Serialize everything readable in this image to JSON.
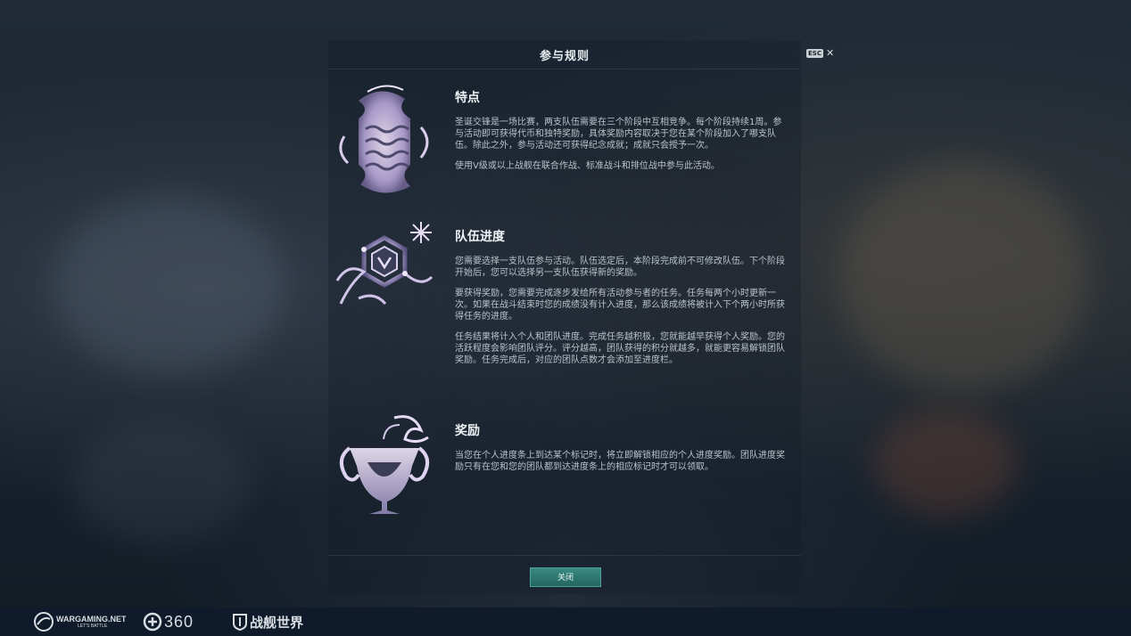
{
  "dialog": {
    "title": "参与规则",
    "esc_label": "ESC",
    "close_glyph": "✕",
    "close_button_label": "关闭"
  },
  "sections": [
    {
      "title": "特点",
      "icon": "waves-emblem-icon",
      "paragraphs": [
        "圣诞交锋是一场比赛，两支队伍需要在三个阶段中互相竞争。每个阶段持续1周。参与活动即可获得代币和独特奖励，具体奖励内容取决于您在某个阶段加入了哪支队伍。除此之外，参与活动还可获得纪念成就；成就只会授予一次。",
        "使用V级或以上战舰在联合作战、标准战斗和排位战中参与此活动。"
      ]
    },
    {
      "title": "队伍进度",
      "icon": "snowflake-emblem-icon",
      "paragraphs": [
        "您需要选择一支队伍参与活动。队伍选定后，本阶段完成前不可修改队伍。下个阶段开始后，您可以选择另一支队伍获得新的奖励。",
        "要获得奖励，您需要完成逐步发给所有活动参与者的任务。任务每两个小时更新一次。如果在战斗结束时您的成绩没有计入进度，那么该成绩将被计入下个两小时所获得任务的进度。",
        "任务结果将计入个人和团队进度。完成任务越积极，您就能越早获得个人奖励。您的活跃程度会影响团队评分。评分越高，团队获得的积分就越多，就能更容易解锁团队奖励。任务完成后，对应的团队点数才会添加至进度栏。"
      ]
    },
    {
      "title": "奖励",
      "icon": "cup-emblem-icon",
      "paragraphs": [
        "当您在个人进度条上到达某个标记时，将立即解锁相应的个人进度奖励。团队进度奖励只有在您和您的团队都到达进度条上的相应标记时才可以领取。"
      ]
    }
  ],
  "footer": {
    "wargaming": "WARGAMING.NET",
    "wargaming_sub": "LET'S BATTLE",
    "partner_360": "360",
    "game_logo": "战舰世界"
  },
  "colors": {
    "accent": "#2f7d76",
    "bottom_bar": "#0f1a2b"
  }
}
